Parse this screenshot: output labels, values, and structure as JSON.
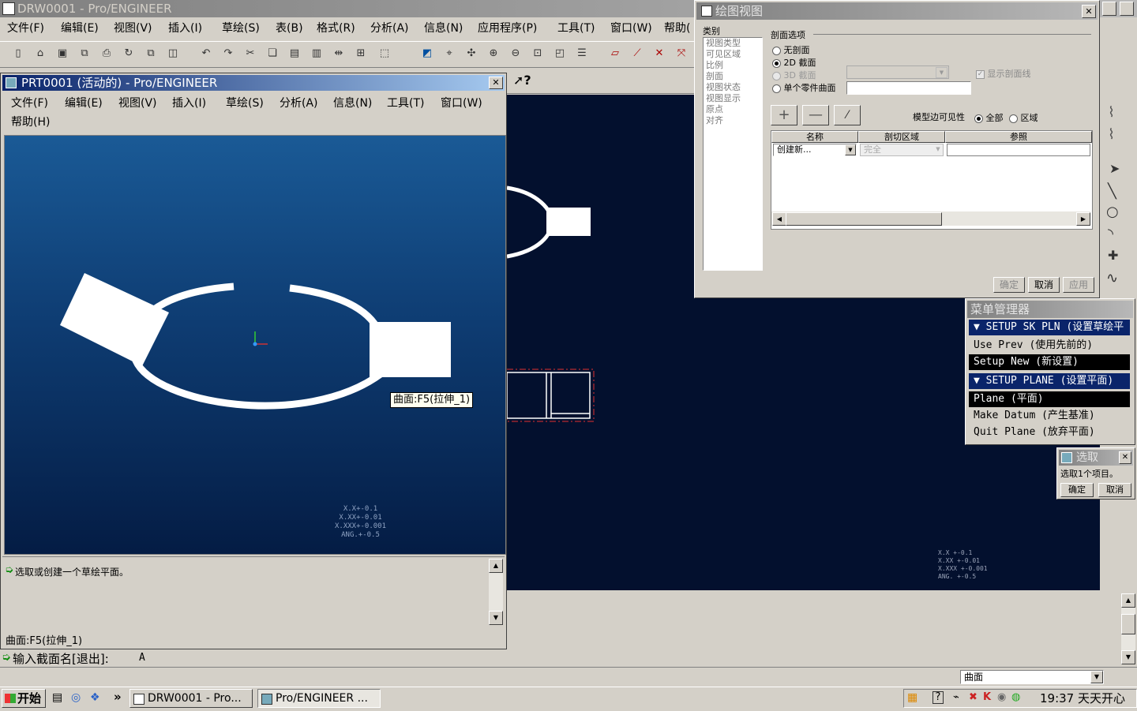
{
  "main_window": {
    "title": "DRW0001 - Pro/ENGINEER",
    "menu": [
      "文件(F)",
      "编辑(E)",
      "视图(V)",
      "插入(I)",
      "草绘(S)",
      "表(B)",
      "格式(R)",
      "分析(A)",
      "信息(N)",
      "应用程序(P)",
      "工具(T)",
      "窗口(W)",
      "帮助("
    ],
    "status_input_label": "输入截面名[退出]:",
    "status_input_value": "A",
    "filter_value": "曲面",
    "tolerance_lines": [
      "X.X  +-0.1",
      "X.XX  +-0.01",
      "X.XXX +-0.001",
      "ANG.  +-0.5"
    ]
  },
  "part_window": {
    "title": "PRT0001 (活动的) - Pro/ENGINEER",
    "menu_row1": [
      "文件(F)",
      "编辑(E)",
      "视图(V)",
      "插入(I)",
      "草绘(S)",
      "分析(A)",
      "信息(N)",
      "工具(T)",
      "窗口(W)"
    ],
    "menu_row2": [
      "帮助(H)"
    ],
    "tooltip": "曲面:F5(拉伸_1)",
    "message": "选取或创建一个草绘平面。",
    "status": "曲面:F5(拉伸_1)",
    "tolerance_lines": [
      "X.X+-0.1",
      "X.XX+-0.01",
      "X.XXX+-0.001",
      "ANG.+-0.5"
    ],
    "colors": {
      "viewport_top": "#1a5a96",
      "viewport_bottom": "#041c44"
    }
  },
  "drawing_view_dialog": {
    "title": "绘图视图",
    "category_label": "类别",
    "categories": [
      "视图类型",
      "可见区域",
      "比例",
      "剖面",
      "视图状态",
      "视图显示",
      "原点",
      "对齐"
    ],
    "section_options_label": "剖面选项",
    "options": [
      "无剖面",
      "2D 截面",
      "3D 截面",
      "单个零件曲面"
    ],
    "show_section_line": "显示剖面线",
    "model_edge_visibility": "模型边可见性",
    "visibility_all": "全部",
    "visibility_area": "区域",
    "columns": [
      "名称",
      "剖切区域",
      "参照"
    ],
    "row": {
      "name": "创建新...",
      "area": "完全",
      "ref": ""
    },
    "buttons": {
      "ok": "确定",
      "cancel": "取消",
      "apply": "应用"
    }
  },
  "menu_manager": {
    "title": "菜单管理器",
    "header1": "SETUP SK PLN (设置草绘平",
    "items1": [
      "Use Prev (使用先前的)",
      "Setup New (新设置)"
    ],
    "header2": "SETUP PLANE (设置平面)",
    "items2": [
      "Plane (平面)",
      "Make Datum (产生基准)",
      "Quit Plane (放弃平面)"
    ]
  },
  "select_dialog": {
    "title": "选取",
    "message": "选取1个项目。",
    "ok": "确定",
    "cancel": "取消"
  },
  "taskbar": {
    "start": "开始",
    "tasks": [
      "DRW0001 - Pro...",
      "Pro/ENGINEER ..."
    ],
    "clock": "19:37 天天开心"
  }
}
